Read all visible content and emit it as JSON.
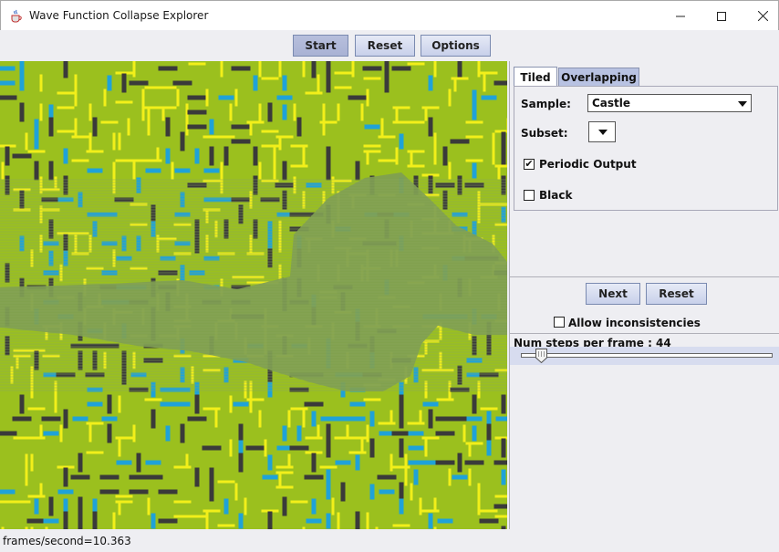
{
  "window": {
    "title": "Wave Function Collapse Explorer",
    "icon": "java-cup-icon"
  },
  "toolbar": {
    "start_label": "Start",
    "reset_label": "Reset",
    "options_label": "Options"
  },
  "tabs": {
    "tiled_label": "Tiled",
    "overlapping_label": "Overlapping",
    "active": "Tiled"
  },
  "tiled_panel": {
    "sample_label": "Sample:",
    "sample_value": "Castle",
    "subset_label": "Subset:",
    "subset_value": "",
    "periodic_label": "Periodic Output",
    "periodic_checked": true,
    "black_label": "Black",
    "black_checked": false
  },
  "controls": {
    "next_label": "Next",
    "reset_label": "Reset",
    "allow_label": "Allow inconsistencies",
    "allow_checked": false,
    "steps_label": "Num steps per frame : 44",
    "steps_value": 44
  },
  "status": {
    "text": "frames/second=10.363"
  },
  "colors": {
    "grass": "#9bc01e",
    "wall_yellow": "#f2ef1a",
    "water_blue": "#1fa2d8",
    "road_dark": "#3a3a3a",
    "unresolved": "#7f9e52"
  }
}
